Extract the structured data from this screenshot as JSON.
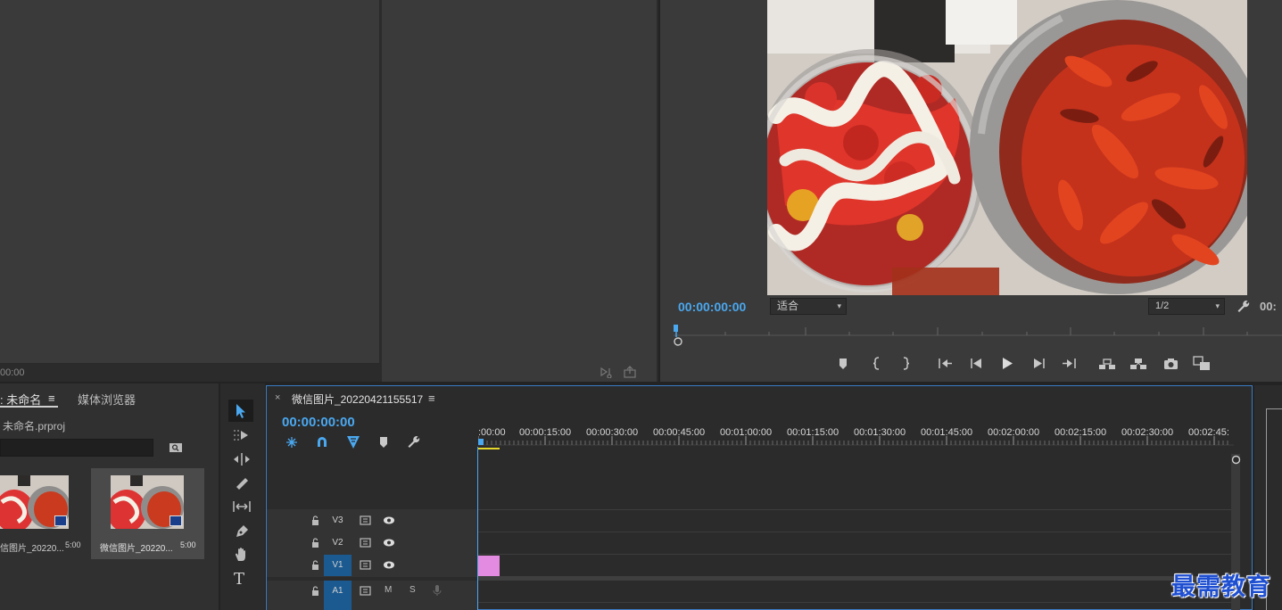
{
  "source": {
    "timecode": "00:00"
  },
  "program": {
    "timecode": "00:00:00:00",
    "fit_select": "适合",
    "resolution_select": "1/2",
    "right_timecode": "00:"
  },
  "project": {
    "tab_project": ": 未命名",
    "tab_media_browser": "媒体浏览器",
    "project_file": "未命名.prproj",
    "search_placeholder": "",
    "items": [
      {
        "name": "信图片_20220...",
        "duration": "5:00"
      },
      {
        "name": "微信图片_20220...",
        "duration": "5:00"
      }
    ]
  },
  "timeline": {
    "close": "×",
    "sequence_name": "微信图片_20220421155517",
    "timecode": "00:00:00:00",
    "ruler_labels": [
      ":00:00",
      "00:00:15:00",
      "00:00:30:00",
      "00:00:45:00",
      "00:01:00:00",
      "00:01:15:00",
      "00:01:30:00",
      "00:01:45:00",
      "00:02:00:00",
      "00:02:15:00",
      "00:02:30:00",
      "00:02:45:"
    ],
    "tracks": {
      "v3": "V3",
      "v2": "V2",
      "v1": "V1",
      "a1": "A1",
      "mute": "M",
      "solo": "S"
    },
    "clip_color": "#e38be0"
  },
  "watermark": "最需教育",
  "colors": {
    "accent": "#4aa8f0",
    "track_active": "#1b5a91",
    "timeline_border": "#3a7bc4"
  }
}
